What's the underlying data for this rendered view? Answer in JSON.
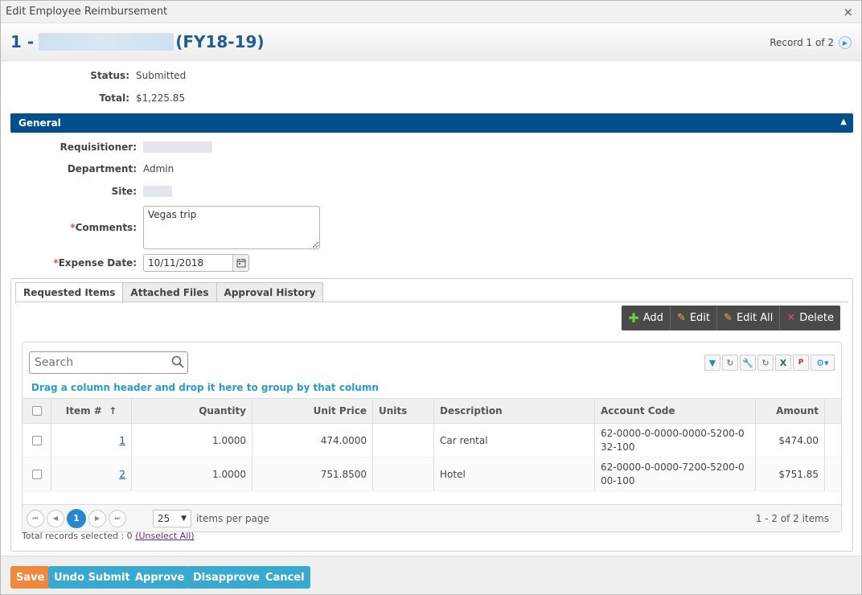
{
  "window": {
    "title": "Edit Employee Reimbursement",
    "close": "×"
  },
  "record": {
    "prefix": "1 -",
    "suffix": "(FY18-19)",
    "nav": "Record 1 of 2"
  },
  "summary": {
    "status_label": "Status:",
    "status_value": "Submitted",
    "total_label": "Total:",
    "total_value": "$1,225.85"
  },
  "section": {
    "title": "General"
  },
  "form": {
    "requisitioner_label": "Requisitioner:",
    "department_label": "Department:",
    "department_value": "Admin",
    "site_label": "Site:",
    "comments_label": "Comments:",
    "comments_value": "Vegas trip",
    "expense_date_label": "Expense Date:",
    "expense_date_value": "10/11/2018",
    "required_mark": "*"
  },
  "tabs": [
    "Requested Items",
    "Attached Files",
    "Approval History"
  ],
  "toolbar": {
    "add": "Add",
    "edit": "Edit",
    "edit_all": "Edit All",
    "delete": "Delete"
  },
  "grid": {
    "search_placeholder": "Search",
    "group_hint": "Drag a column header and drop it here to group by that column",
    "columns": [
      "Item #",
      "Quantity",
      "Unit Price",
      "Units",
      "Description",
      "Account Code",
      "Amount"
    ],
    "sort_indicator": "↑",
    "rows": [
      {
        "item": "1",
        "quantity": "1.0000",
        "unit_price": "474.0000",
        "units": "",
        "description": "Car rental",
        "account_code": "62-0000-0-0000-0000-5200-032-100",
        "amount": "$474.00"
      },
      {
        "item": "2",
        "quantity": "1.0000",
        "unit_price": "751.8500",
        "units": "",
        "description": "Hotel",
        "account_code": "62-0000-0-0000-7200-5200-000-100",
        "amount": "$751.85"
      }
    ],
    "pager": {
      "current_page": "1",
      "page_size": "25",
      "per_page_label": "items per page",
      "info": "1 - 2 of 2 items"
    },
    "selected_text": "Total records selected : 0",
    "unselect_all": "(Unselect All)"
  },
  "footer": {
    "save": "Save",
    "undo_submit": "Undo Submit",
    "approve": "Approve",
    "disapprove": "Disapprove",
    "cancel": "Cancel"
  },
  "colors": {
    "accent": "#01508d",
    "title_blue": "#1f5c94",
    "save": "#f0873a",
    "action": "#39a9cf",
    "toolbar": "#4a4a4a",
    "link": "#2a9bc9"
  }
}
